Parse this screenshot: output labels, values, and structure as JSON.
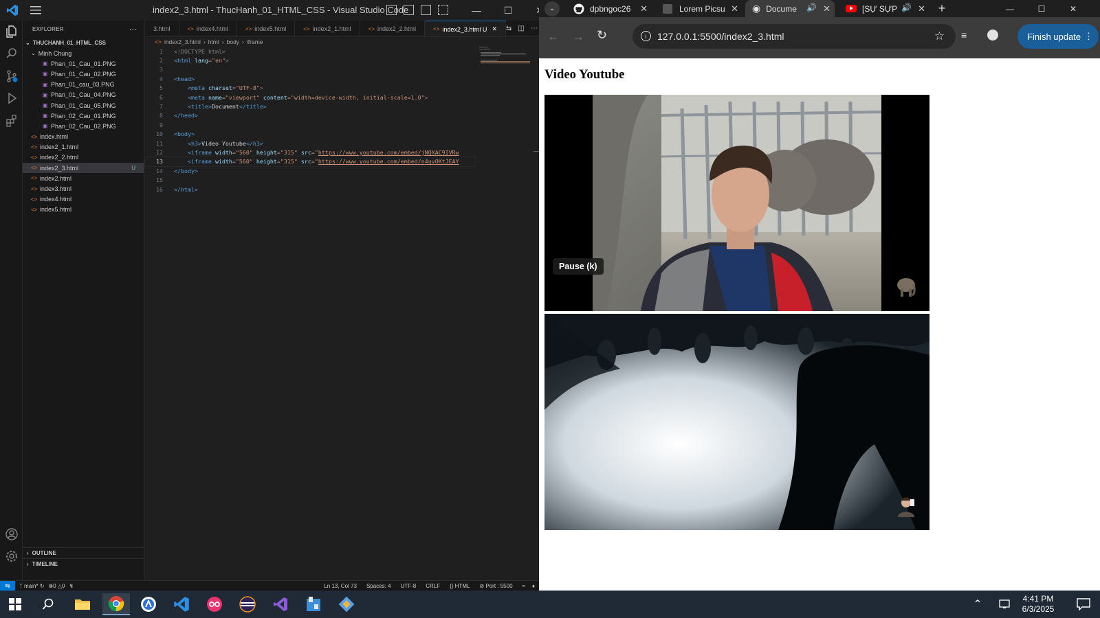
{
  "vscode": {
    "title": "index2_3.html - ThucHanh_01_HTML_CSS - Visual Studio Code",
    "explorer_label": "EXPLORER",
    "project": "THUCHANH_01_HTML_CSS",
    "folder": "Minh Chung",
    "images": [
      "Phan_01_Cau_01.PNG",
      "Phan_01_Cau_02.PNG",
      "Phan_01_cau_03.PNG",
      "Phan_01_Cau_04.PNG",
      "Phan_01_Cau_05.PNG",
      "Phan_02_Cau_01.PNG",
      "Phan_02_Cau_02.PNG"
    ],
    "files": [
      "index.html",
      "index2_1.html",
      "index2_2.html",
      "index2_3.html",
      "index2.html",
      "index3.html",
      "index4.html",
      "index5.html"
    ],
    "selected_file_badge": "U",
    "outline": "OUTLINE",
    "timeline": "TIMELINE",
    "tabs": [
      "3.html",
      "index4.html",
      "index5.html",
      "index2_1.html",
      "index2_2.html",
      "index2_3.html U"
    ],
    "breadcrumb": [
      "index2_3.html",
      "html",
      "body",
      "iframe"
    ],
    "code": {
      "l1": "<!DOCTYPE html>",
      "l2a": "<html ",
      "l2b": "lang",
      "l2c": "=\"en\"",
      "l2d": ">",
      "l4": "<head>",
      "l5a": "    <meta ",
      "l5b": "charset",
      "l5c": "=\"UTF-8\"",
      "l5d": ">",
      "l6a": "    <meta ",
      "l6b": "name",
      "l6c": "=\"viewport\"",
      "l6d": " content",
      "l6e": "=\"width=device-width, initial-scale=1.0\"",
      "l6f": ">",
      "l7a": "    <title>",
      "l7b": "Document",
      "l7c": "</title>",
      "l8": "</head>",
      "l10": "<body>",
      "l11a": "    <h3>",
      "l11b": "Video Youtube",
      "l11c": "</h3>",
      "l12a": "    <iframe ",
      "l12b": "width",
      "l12c": "=\"560\"",
      "l12d": " height",
      "l12e": "=\"315\"",
      "l12f": " src",
      "l12g": "=\"",
      "l12h": "https://www.youtube.com/embed/jNQXAC9IVRw",
      "l13a": "    <iframe ",
      "l13b": "width",
      "l13c": "=\"560\"",
      "l13d": " height",
      "l13e": "=\"315\"",
      "l13f": " src",
      "l13g": "=\"",
      "l13h": "https://www.youtube.com/embed/n4uvOKtJEAY",
      "l14": "</body>",
      "l16": "</html>"
    },
    "status": {
      "branch": "main*",
      "errors": "0",
      "warnings": "0",
      "position": "Ln 13, Col 73",
      "spaces": "Spaces: 4",
      "encoding": "UTF-8",
      "eol": "CRLF",
      "language": "HTML",
      "port": "Port : 5500"
    }
  },
  "chrome": {
    "tabs": [
      "dpbngoc26",
      "Lorem Picsu",
      "Docume",
      "[SỰ SỰP"
    ],
    "url": "127.0.0.1:5500/index2_3.html",
    "finish_update": "Finish update"
  },
  "page": {
    "heading": "Video Youtube",
    "pause_tooltip": "Pause (k)"
  },
  "taskbar": {
    "time": "4:41 PM",
    "date": "6/3/2025"
  }
}
